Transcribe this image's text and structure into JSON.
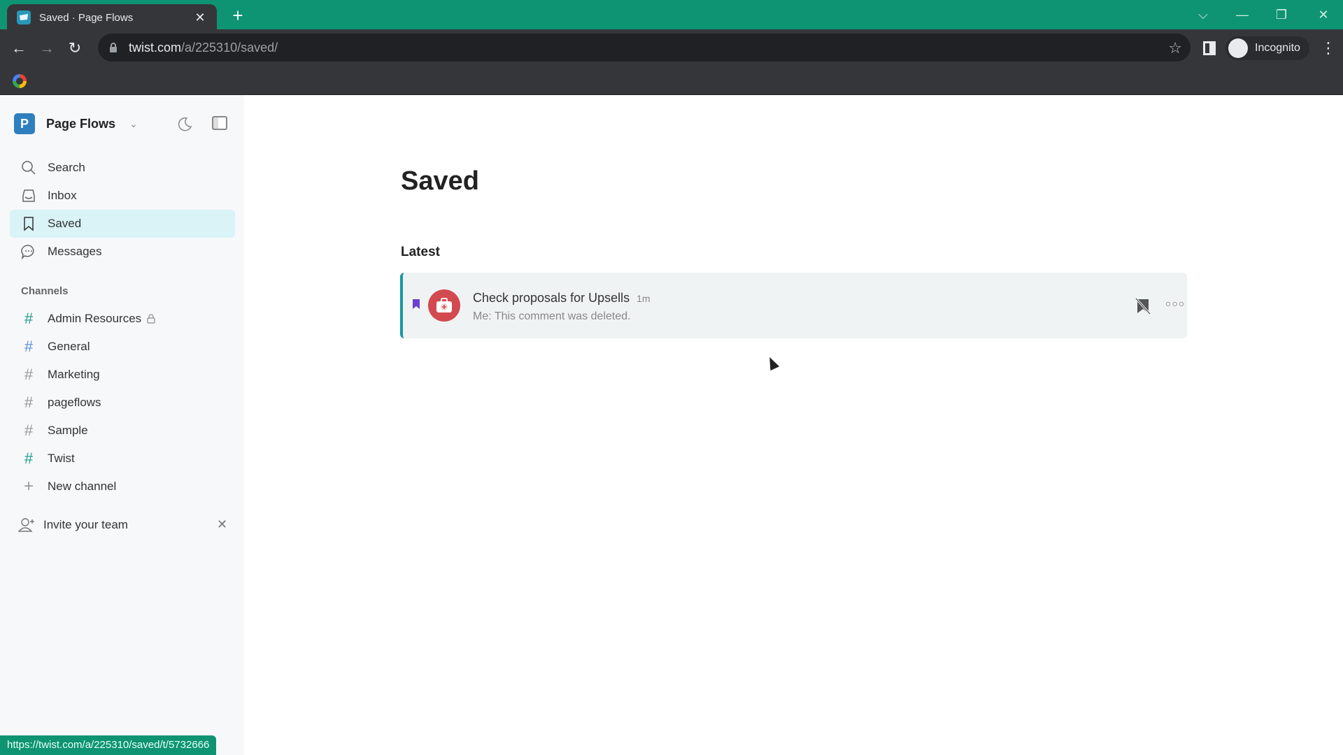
{
  "browser": {
    "tab_title": "Saved · Page Flows",
    "new_tab_label": "+",
    "url_host": "twist.com",
    "url_path": "/a/225310/saved/",
    "profile_label": "Incognito",
    "status_url": "https://twist.com/a/225310/saved/t/5732666",
    "accent_color": "#0f9473"
  },
  "sidebar": {
    "workspace_initial": "P",
    "workspace_name": "Page Flows",
    "nav": [
      {
        "label": "Search",
        "icon": "search-icon"
      },
      {
        "label": "Inbox",
        "icon": "inbox-icon"
      },
      {
        "label": "Saved",
        "icon": "bookmark-icon",
        "active": true
      },
      {
        "label": "Messages",
        "icon": "chat-bubble-icon"
      }
    ],
    "channels_heading": "Channels",
    "channels": [
      {
        "label": "Admin Resources",
        "private": true,
        "hash_color": "#1b9c8a"
      },
      {
        "label": "General",
        "hash_color": "#5b8fd4"
      },
      {
        "label": "Marketing",
        "hash_color": "#999999"
      },
      {
        "label": "pageflows",
        "hash_color": "#999999"
      },
      {
        "label": "Sample",
        "hash_color": "#999999"
      },
      {
        "label": "Twist",
        "hash_color": "#1b9c8a"
      }
    ],
    "new_channel_label": "New channel",
    "invite_label": "Invite your team"
  },
  "main": {
    "title": "Saved",
    "section": "Latest",
    "items": [
      {
        "title": "Check proposals for Upsells",
        "time": "1m",
        "snippet": "Me: This comment was deleted."
      }
    ]
  }
}
